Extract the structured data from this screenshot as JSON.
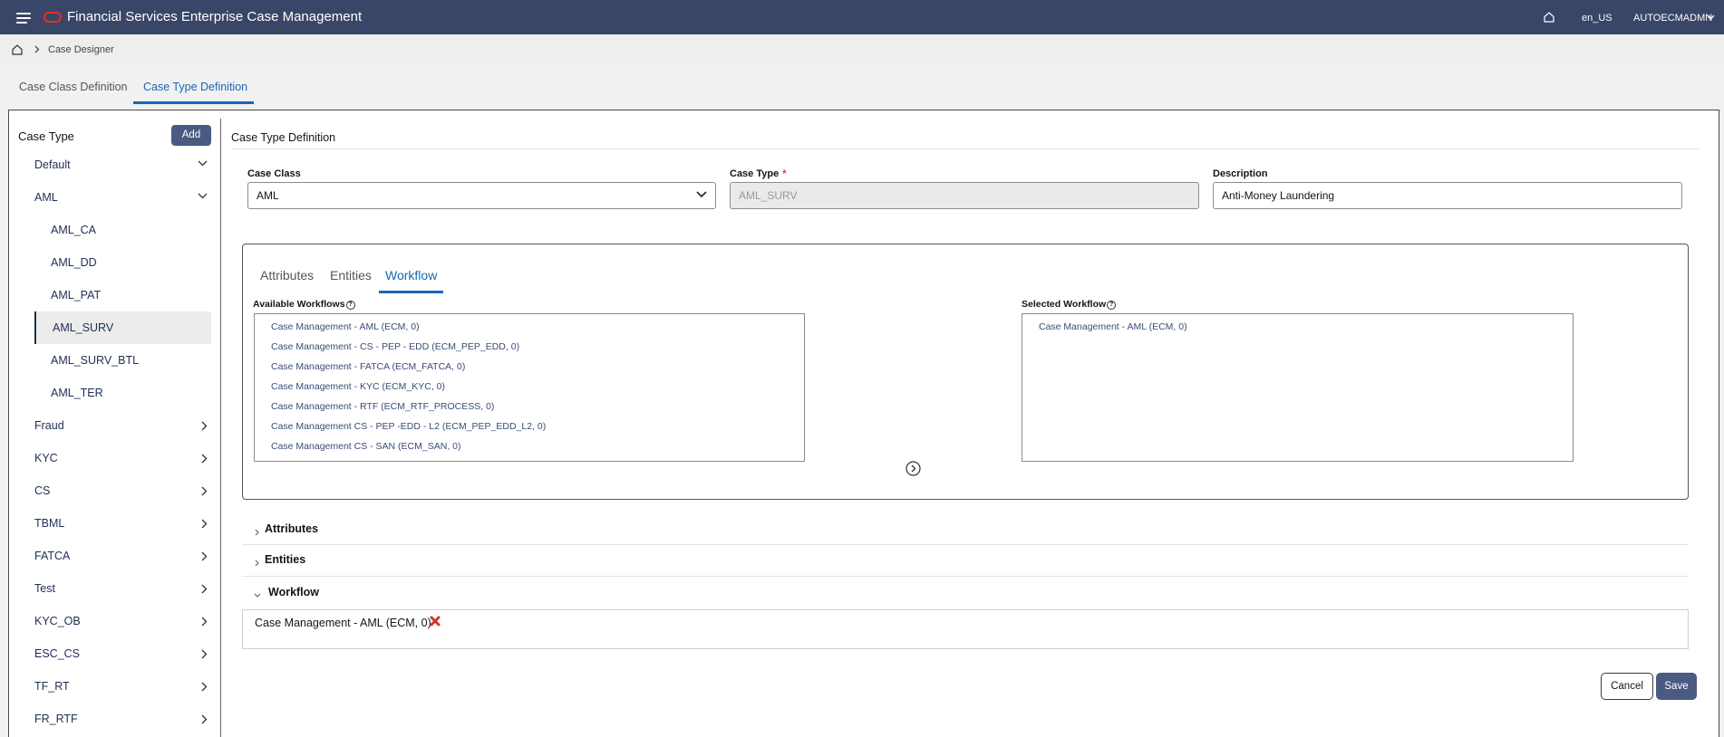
{
  "app": {
    "title": "Financial Services Enterprise Case Management",
    "lang": "en_US",
    "user": "AUTOECMADMN"
  },
  "breadcrumb": {
    "current": "Case Designer"
  },
  "tabs": [
    "Case Class Definition",
    "Case Type Definition"
  ],
  "active_tab": "Case Type Definition",
  "left": {
    "title": "Case Type",
    "add_label": "Add",
    "tree": [
      {
        "label": "Default",
        "expanded": true
      },
      {
        "label": "AML",
        "expanded": true,
        "children": [
          "AML_CA",
          "AML_DD",
          "AML_PAT",
          "AML_SURV",
          "AML_SURV_BTL",
          "AML_TER"
        ],
        "selected_child": "AML_SURV"
      },
      {
        "label": "Fraud"
      },
      {
        "label": "KYC"
      },
      {
        "label": "CS"
      },
      {
        "label": "TBML"
      },
      {
        "label": "FATCA"
      },
      {
        "label": "Test"
      },
      {
        "label": "KYC_OB"
      },
      {
        "label": "ESC_CS"
      },
      {
        "label": "TF_RT"
      },
      {
        "label": "FR_RTF"
      }
    ]
  },
  "form": {
    "section_title": "Case Type Definition",
    "case_class_label": "Case Class",
    "case_class_value": "AML",
    "case_type_label": "Case Type",
    "required_mark": "*",
    "case_type_value": "AML_SURV",
    "description_label": "Description",
    "description_value": "Anti-Money Laundering"
  },
  "inner_tabs": [
    "Attributes",
    "Entities",
    "Workflow"
  ],
  "inner_active": "Workflow",
  "workflow": {
    "available_label": "Available Workflows",
    "help_glyph": "?",
    "available": [
      "Case Management - AML (ECM, 0)",
      "Case Management - CS - PEP - EDD (ECM_PEP_EDD, 0)",
      "Case Management - FATCA (ECM_FATCA, 0)",
      "Case Management - KYC (ECM_KYC, 0)",
      "Case Management - RTF (ECM_RTF_PROCESS, 0)",
      "Case Management CS - PEP -EDD - L2 (ECM_PEP_EDD_L2, 0)",
      "Case Management CS - SAN (ECM_SAN, 0)"
    ],
    "selected_label": "Selected Workflow",
    "selected": [
      "Case Management - AML (ECM, 0)"
    ]
  },
  "accordion": {
    "attributes": "Attributes",
    "entities": "Entities",
    "workflow": "Workflow",
    "workflow_item": "Case Management - AML (ECM, 0)"
  },
  "actions": {
    "cancel": "Cancel",
    "save": "Save"
  },
  "colors": {
    "topbar": "#3a4668",
    "accent": "#1a66b3",
    "primary_button": "#4a5a82",
    "remove": "#d1352b",
    "oracle": "#e5301d"
  },
  "icons": [
    "menu-icon",
    "oracle-logo",
    "home-icon",
    "chevron-down-icon",
    "chevron-right-icon",
    "help-icon",
    "arrow-right-circle-icon",
    "close-icon"
  ]
}
